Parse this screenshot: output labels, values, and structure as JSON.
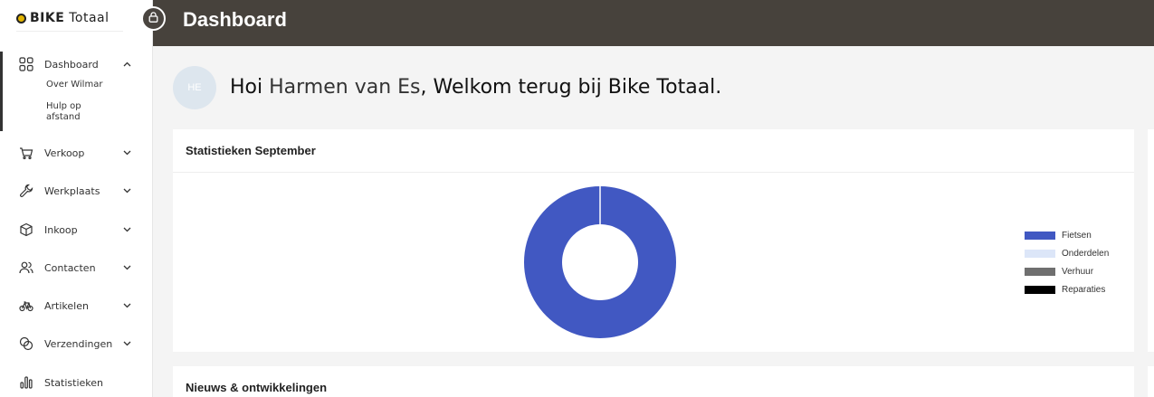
{
  "brand": {
    "logo_bold": "BIKE",
    "logo_light": "Totaal"
  },
  "header": {
    "title": "Dashboard"
  },
  "sidebar": {
    "items": [
      {
        "label": "Dashboard",
        "icon": "grid-icon",
        "expanded": true,
        "children": [
          "Over Wilmar",
          "Hulp op afstand"
        ]
      },
      {
        "label": "Verkoop",
        "icon": "cart-icon"
      },
      {
        "label": "Werkplaats",
        "icon": "wrench-icon"
      },
      {
        "label": "Inkoop",
        "icon": "box-icon"
      },
      {
        "label": "Contacten",
        "icon": "users-icon"
      },
      {
        "label": "Artikelen",
        "icon": "bike-icon"
      },
      {
        "label": "Verzendingen",
        "icon": "shipping-icon"
      },
      {
        "label": "Statistieken",
        "icon": "bar-chart-icon"
      }
    ]
  },
  "welcome": {
    "avatar_initials": "HE",
    "greeting": "Hoi",
    "user_name": "Harmen van Es",
    "message": ", Welkom terug bij Bike Totaal."
  },
  "stats_card": {
    "title": "Statistieken September"
  },
  "news_card": {
    "title": "Nieuws & ontwikkelingen"
  },
  "colors": {
    "topbar": "#47423c",
    "accent": "#4158c2"
  },
  "chart_data": {
    "type": "pie",
    "donut": true,
    "labels": [
      "Fietsen",
      "Onderdelen",
      "Verhuur",
      "Reparaties"
    ],
    "values": [
      100,
      0,
      0,
      0
    ],
    "colors": [
      "#4158c2",
      "#dce6f8",
      "#6f6f6f",
      "#000000"
    ],
    "legend_position": "right"
  }
}
